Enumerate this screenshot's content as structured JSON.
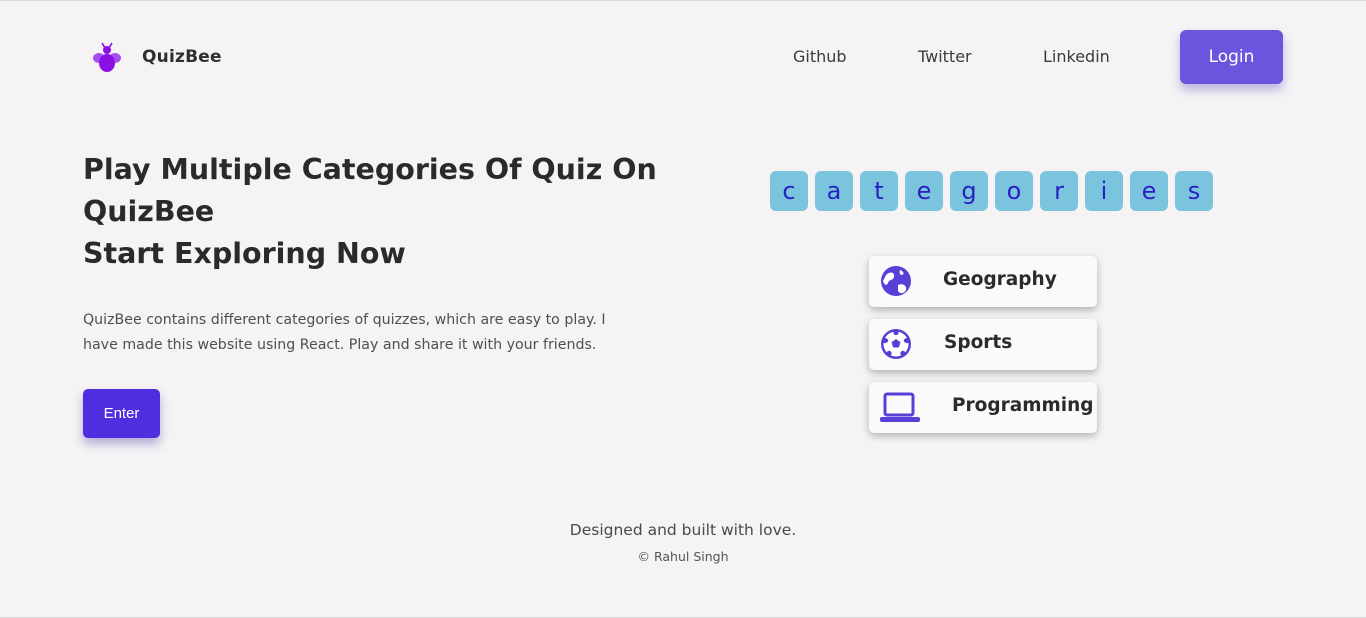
{
  "header": {
    "brand": "QuizBee",
    "nav": [
      "Github",
      "Twitter",
      "Linkedin"
    ],
    "login_label": "Login"
  },
  "hero": {
    "title_line1": "Play Multiple Categories Of Quiz On",
    "title_line2": "QuizBee",
    "title_line3": "Start Exploring Now",
    "description": "QuizBee contains different categories of quizzes, which are easy to play. I have made this website using React. Play and share it with your friends.",
    "enter_label": "Enter"
  },
  "tiles": [
    "c",
    "a",
    "t",
    "e",
    "g",
    "o",
    "r",
    "i",
    "e",
    "s"
  ],
  "categories": [
    {
      "label": "Geography",
      "icon": "globe-icon"
    },
    {
      "label": "Sports",
      "icon": "soccer-ball-icon"
    },
    {
      "label": "Programming",
      "icon": "laptop-icon"
    }
  ],
  "footer": {
    "tagline": "Designed and built with love.",
    "credit": "© Rahul Singh"
  },
  "colors": {
    "accent": "#6a55df",
    "enter": "#4f2ee0",
    "tile_bg": "#7bc4de",
    "tile_text": "#2a1fc2",
    "icon": "#5a3fd6",
    "logo": "#8a10e6"
  }
}
